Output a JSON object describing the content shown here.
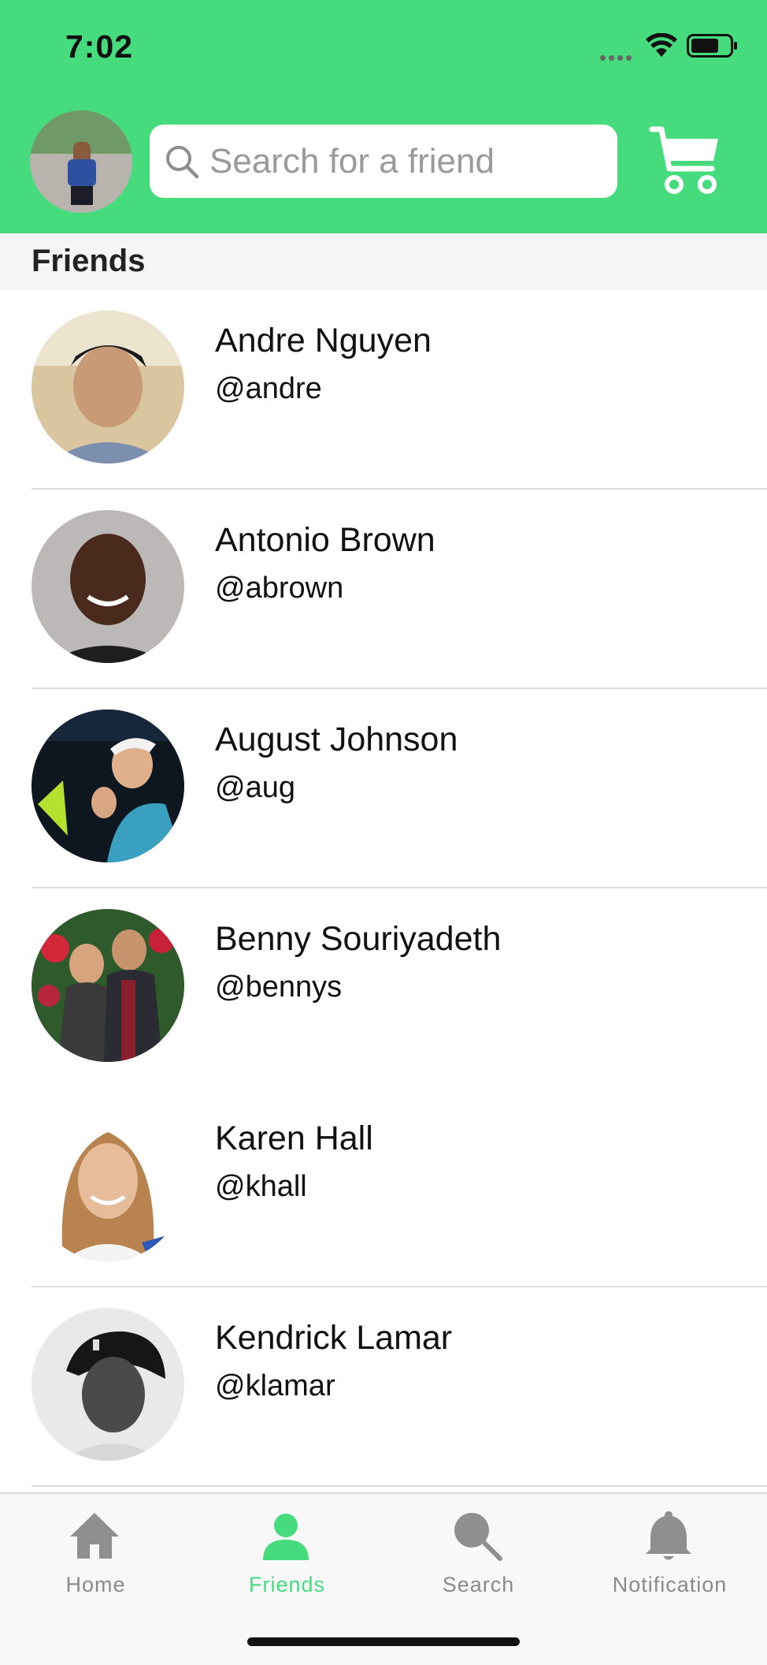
{
  "status_bar": {
    "time": "7:02"
  },
  "header": {
    "search_placeholder": "Search for a friend",
    "profile_avatar_icon": "user-photo",
    "cart_icon": "shopping-cart-icon",
    "accent_color": "#46dc7e"
  },
  "section": {
    "title": "Friends"
  },
  "friends": [
    {
      "name": "Andre Nguyen",
      "handle": "@andre"
    },
    {
      "name": "Antonio Brown",
      "handle": "@abrown"
    },
    {
      "name": "August Johnson",
      "handle": "@aug"
    },
    {
      "name": "Benny Souriyadeth",
      "handle": "@bennys"
    },
    {
      "name": "Karen Hall",
      "handle": "@khall"
    },
    {
      "name": "Kendrick Lamar",
      "handle": "@klamar"
    }
  ],
  "tab_bar": {
    "tabs": [
      {
        "label": "Home",
        "icon": "home-icon",
        "active": false
      },
      {
        "label": "Friends",
        "icon": "person-icon",
        "active": true
      },
      {
        "label": "Search",
        "icon": "search-icon",
        "active": false
      },
      {
        "label": "Notification",
        "icon": "bell-icon",
        "active": false
      }
    ]
  }
}
